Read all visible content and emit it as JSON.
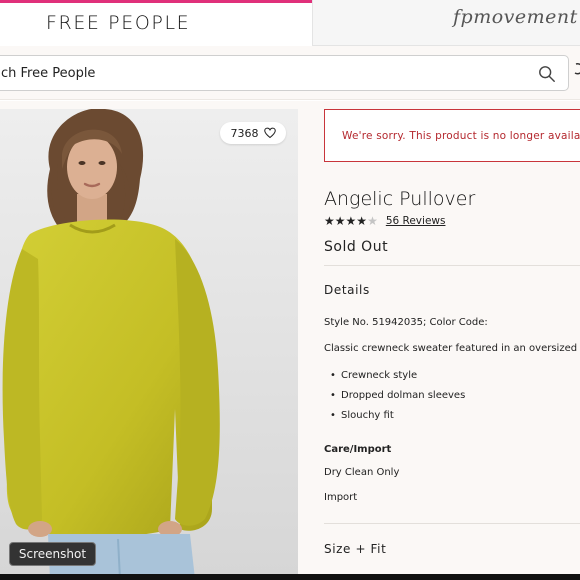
{
  "brands": {
    "primary_tab": "FREE PEOPLE",
    "secondary_tab": "fpmovement",
    "accent_color": "#e0307a"
  },
  "search": {
    "placeholder": "ch Free People",
    "icon": "search-icon"
  },
  "product": {
    "likes": "7368",
    "likes_icon": "heart-icon",
    "alert": "We're sorry. This product is no longer available.",
    "alert_color": "#c8353b",
    "title": "Angelic Pullover",
    "rating": 4,
    "rating_max": 5,
    "reviews": "56 Reviews",
    "status": "Sold Out",
    "details_heading": "Details",
    "style_line": "Style No. 51942035; Color Code:",
    "description": "Classic crewneck sweater featured in an oversized pu",
    "features": [
      "Crewneck style",
      "Dropped dolman sleeves",
      "Slouchy fit"
    ],
    "care_heading": "Care/Import",
    "care": "Dry Clean Only",
    "import": "Import",
    "size_heading": "Size + Fit",
    "sweater_color": "#c9c42a"
  },
  "overlay": {
    "screenshot_label": "Screenshot"
  }
}
